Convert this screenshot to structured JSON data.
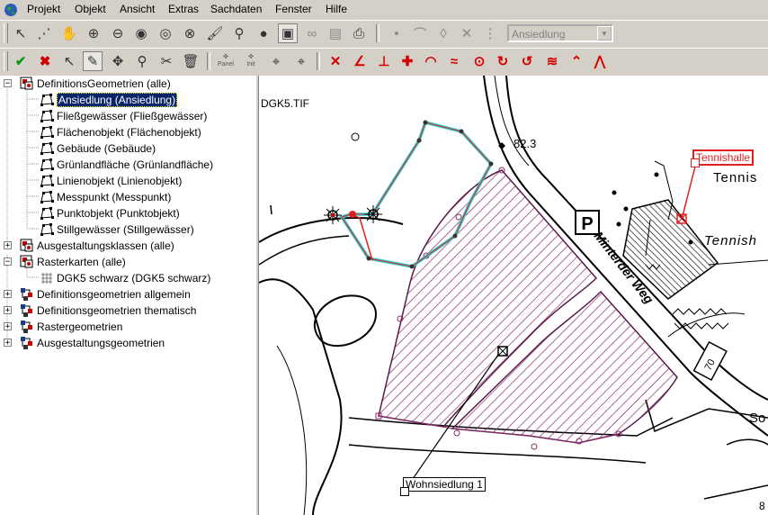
{
  "menubar": {
    "items": [
      "Projekt",
      "Objekt",
      "Ansicht",
      "Extras",
      "Sachdaten",
      "Fenster",
      "Hilfe"
    ]
  },
  "toolbar1": {
    "layer_combo_value": "Ansiedlung"
  },
  "toolbar2": {
    "panel_label": "Panel",
    "init_label": "Init"
  },
  "tree": {
    "items": [
      {
        "label": "DefinitionsGeometrien (alle)"
      },
      {
        "label": "Ansiedlung (Ansiedlung)"
      },
      {
        "label": "Fließgewässer (Fließgewässer)"
      },
      {
        "label": "Flächenobjekt (Flächenobjekt)"
      },
      {
        "label": "Gebäude (Gebäude)"
      },
      {
        "label": "Grünlandfläche (Grünlandfläche)"
      },
      {
        "label": "Linienobjekt (Linienobjekt)"
      },
      {
        "label": "Messpunkt (Messpunkt)"
      },
      {
        "label": "Punktobjekt (Punktobjekt)"
      },
      {
        "label": "Stillgewässer (Stillgewässer)"
      },
      {
        "label": "Ausgestaltungsklassen (alle)"
      },
      {
        "label": "Rasterkarten (alle)"
      },
      {
        "label": "DGK5 schwarz (DGK5 schwarz)"
      },
      {
        "label": "Definitionsgeometrien allgemein"
      },
      {
        "label": "Definitionsgeometrien thematisch"
      },
      {
        "label": "Rastergeometrien"
      },
      {
        "label": "Ausgestaltungsgeometrien"
      }
    ]
  },
  "map": {
    "raster_label": "DGK5.TIF",
    "elevation": "82.3",
    "parking_sign": "P",
    "street_name": "Minterder Weg",
    "tennis_label_1": "Tennis",
    "tennis_label_2": "Tennish",
    "so_label": "So",
    "house_number": "70",
    "edge_digit": "8",
    "tooltip_tennishalle": "Tennishalle",
    "tooltip_wohnsiedlung": "Wohnsiedlung 1",
    "colors": {
      "selection_cyan": "#33cccc",
      "edit_red": "#e02020",
      "polygon_purple": "#8a2a6a"
    }
  }
}
